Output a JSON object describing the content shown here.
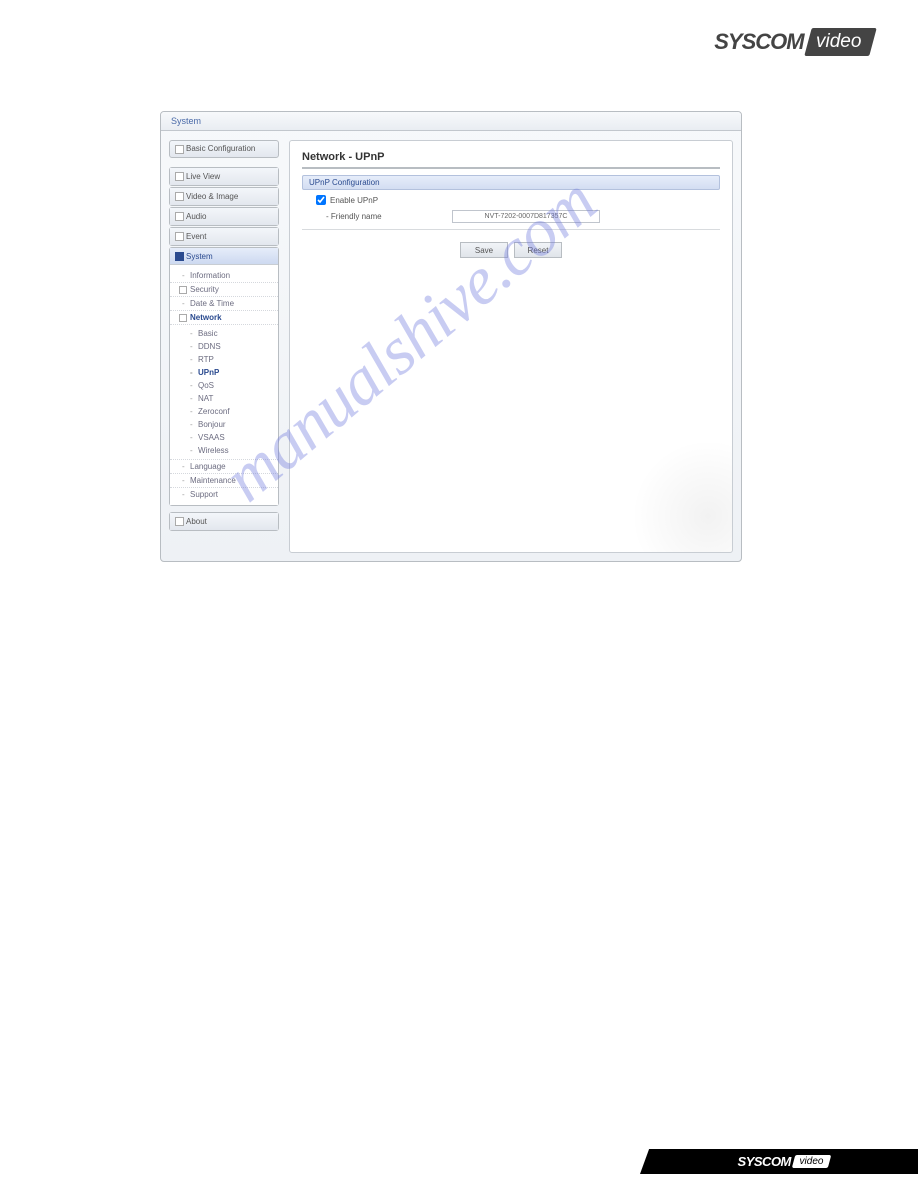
{
  "brand": {
    "name": "SYSCOM",
    "sub": "video"
  },
  "window": {
    "title": "System"
  },
  "sidebar": {
    "basic_config": "Basic Configuration",
    "items": [
      {
        "label": "Live View"
      },
      {
        "label": "Video & Image"
      },
      {
        "label": "Audio"
      },
      {
        "label": "Event"
      }
    ],
    "system_label": "System",
    "tree": {
      "information": "Information",
      "security": "Security",
      "datetime": "Date & Time",
      "network": "Network",
      "network_children": [
        {
          "label": "Basic"
        },
        {
          "label": "DDNS"
        },
        {
          "label": "RTP"
        },
        {
          "label": "UPnP"
        },
        {
          "label": "QoS"
        },
        {
          "label": "NAT"
        },
        {
          "label": "Zeroconf"
        },
        {
          "label": "Bonjour"
        },
        {
          "label": "VSAAS"
        },
        {
          "label": "Wireless"
        }
      ],
      "language": "Language",
      "maintenance": "Maintenance",
      "support": "Support"
    },
    "about": "About"
  },
  "content": {
    "title": "Network - UPnP",
    "section": "UPnP Configuration",
    "enable_label": "Enable UPnP",
    "enable_checked": true,
    "friendly_name_label": "Friendly name",
    "friendly_name_value": "NVT-7202-0007D817357C",
    "save": "Save",
    "reset": "Reset"
  },
  "watermark": "manualshive.com"
}
